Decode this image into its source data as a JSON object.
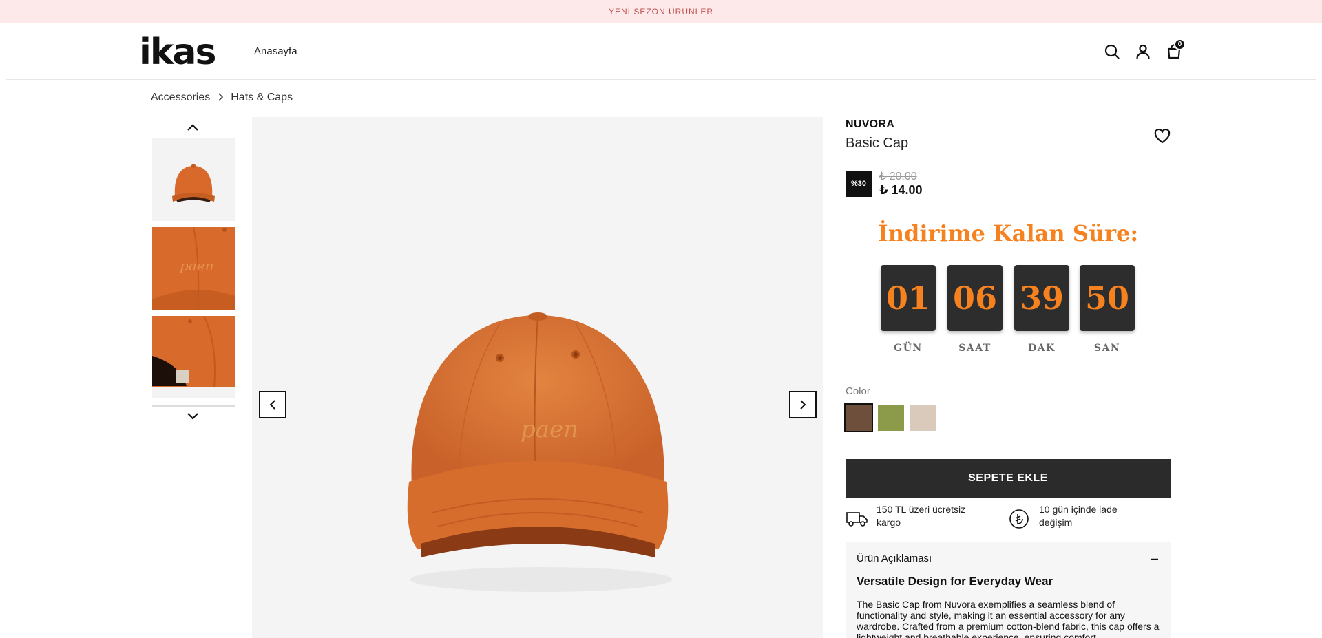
{
  "announcement": "YENİ SEZON ÜRÜNLER",
  "header": {
    "logo": "ikas",
    "nav": [
      "Anasayfa"
    ],
    "cart_count": "0",
    "icons": [
      "search-icon",
      "user-icon",
      "bag-icon"
    ]
  },
  "breadcrumb": [
    "Accessories",
    "Hats & Caps"
  ],
  "gallery": {
    "thumbnails": [
      "cap-front",
      "cap-embroidery-closeup",
      "cap-back-strap"
    ]
  },
  "product": {
    "brand": "NUVORA",
    "name": "Basic Cap",
    "discount_badge": "%30",
    "old_price": "₺ 20.00",
    "price": "₺ 14.00"
  },
  "countdown": {
    "title": "İndirime Kalan Süre:",
    "units": [
      {
        "value": "01",
        "label": "GÜN"
      },
      {
        "value": "06",
        "label": "SAAT"
      },
      {
        "value": "39",
        "label": "DAK"
      },
      {
        "value": "50",
        "label": "SAN"
      }
    ],
    "accent_color": "#f5821f"
  },
  "colors": {
    "label": "Color",
    "swatches": [
      "#6e4f3c",
      "#8c9b4a",
      "#d9cabc"
    ],
    "selected_index": 0
  },
  "actions": {
    "add_to_cart": "SEPETE EKLE"
  },
  "features": [
    {
      "icon": "truck-icon",
      "text": "150 TL üzeri ücretsiz kargo"
    },
    {
      "icon": "lira-icon",
      "text": "10 gün içinde iade değişim"
    }
  ],
  "description": {
    "heading": "Ürün Açıklaması",
    "toggle": "–",
    "subtitle": "Versatile Design for Everyday Wear",
    "body": "The Basic Cap from Nuvora exemplifies a seamless blend of functionality and style, making it an essential accessory for any wardrobe. Crafted from a premium cotton-blend fabric, this cap offers a lightweight and breathable experience, ensuring comfort"
  }
}
